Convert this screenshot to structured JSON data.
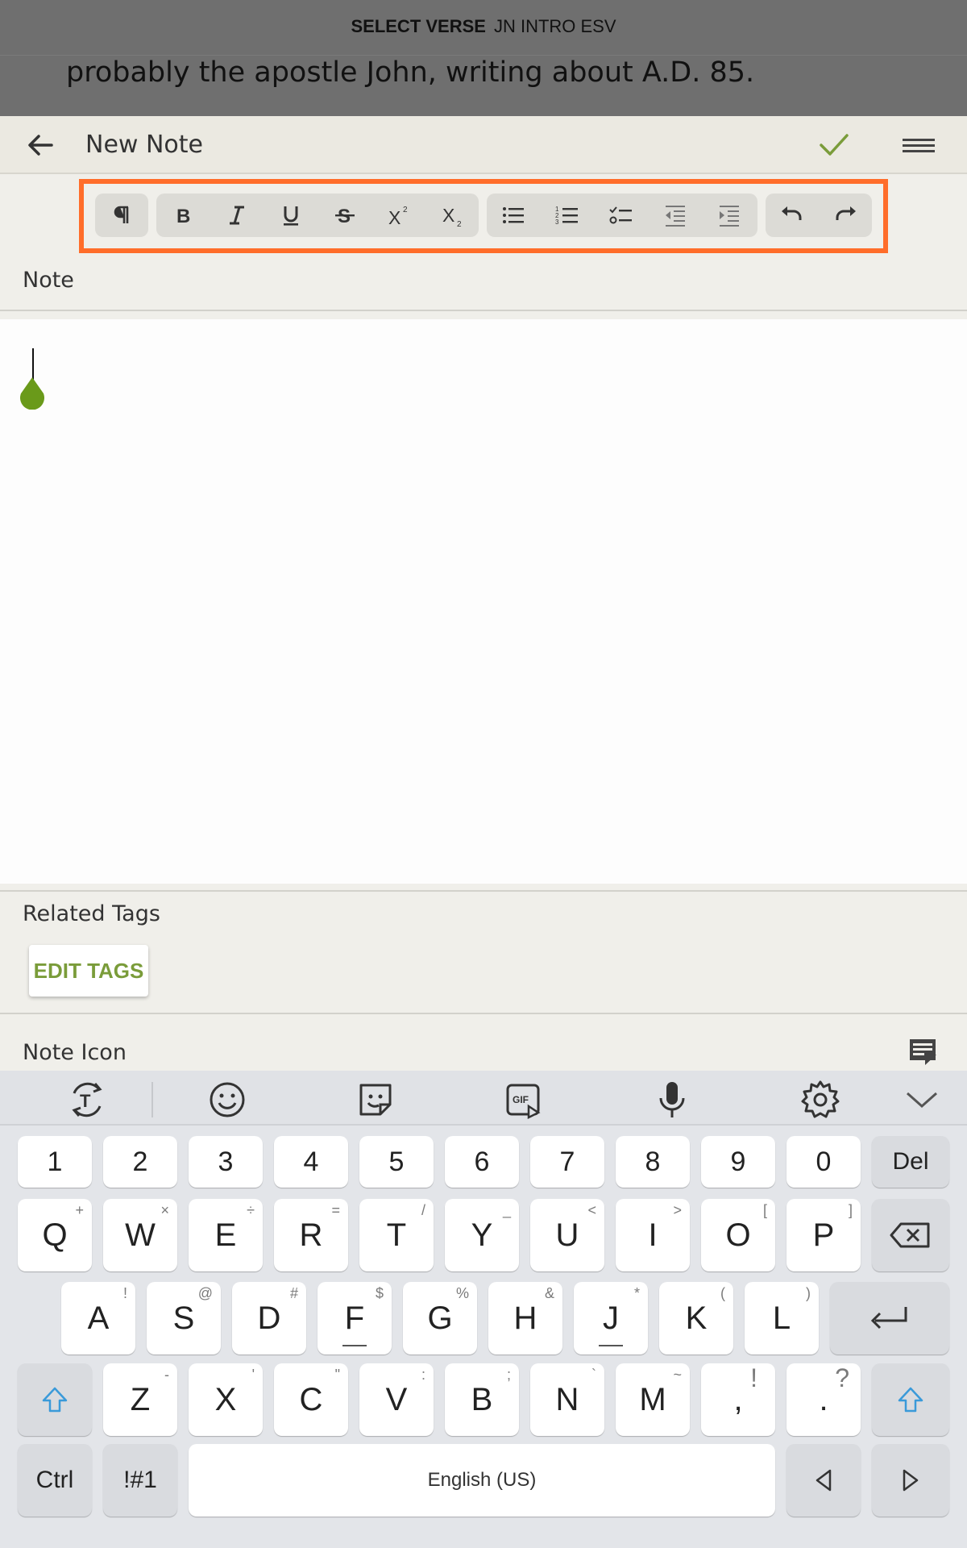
{
  "verse_bar": {
    "select_label": "SELECT VERSE",
    "reference": "JN INTRO ESV",
    "text": "probably the apostle John, writing about A.D. 85."
  },
  "appbar": {
    "title": "New Note"
  },
  "colors": {
    "accent_green": "#7a9c3a",
    "toolbar_highlight": "#ff6d2a",
    "cursor_drop": "#6a9a1a"
  },
  "toolbar": {
    "groups": [
      [
        "paragraph-icon"
      ],
      [
        "bold-icon",
        "italic-icon",
        "underline-icon",
        "strikethrough-icon",
        "superscript-icon",
        "subscript-icon"
      ],
      [
        "bulleted-list-icon",
        "numbered-list-icon",
        "checklist-icon",
        "outdent-icon",
        "indent-icon"
      ],
      [
        "undo-icon",
        "redo-icon"
      ]
    ]
  },
  "note": {
    "label": "Note",
    "content": ""
  },
  "tags": {
    "label": "Related Tags",
    "edit_button": "EDIT TAGS"
  },
  "note_icon": {
    "label": "Note Icon"
  },
  "keyboard": {
    "tools": [
      "text-translate-icon",
      "emoji-icon",
      "sticker-icon",
      "gif-icon",
      "microphone-icon",
      "settings-icon",
      "collapse-icon"
    ],
    "number_row": [
      "1",
      "2",
      "3",
      "4",
      "5",
      "6",
      "7",
      "8",
      "9",
      "0",
      "Del"
    ],
    "row1": [
      {
        "k": "Q",
        "s": "+"
      },
      {
        "k": "W",
        "s": "×"
      },
      {
        "k": "E",
        "s": "÷"
      },
      {
        "k": "R",
        "s": "="
      },
      {
        "k": "T",
        "s": "/"
      },
      {
        "k": "Y",
        "s": "_"
      },
      {
        "k": "U",
        "s": "<"
      },
      {
        "k": "I",
        "s": ">"
      },
      {
        "k": "O",
        "s": "["
      },
      {
        "k": "P",
        "s": "]"
      }
    ],
    "row2": [
      {
        "k": "A",
        "s": "!"
      },
      {
        "k": "S",
        "s": "@"
      },
      {
        "k": "D",
        "s": "#"
      },
      {
        "k": "F",
        "s": "$"
      },
      {
        "k": "G",
        "s": "%"
      },
      {
        "k": "H",
        "s": "&"
      },
      {
        "k": "J",
        "s": "*"
      },
      {
        "k": "K",
        "s": "("
      },
      {
        "k": "L",
        "s": ")"
      }
    ],
    "row3": [
      {
        "k": "Z",
        "s": "-"
      },
      {
        "k": "X",
        "s": "'"
      },
      {
        "k": "C",
        "s": "\""
      },
      {
        "k": "V",
        "s": ":"
      },
      {
        "k": "B",
        "s": ";"
      },
      {
        "k": "N",
        "s": "`"
      },
      {
        "k": "M",
        "s": "~"
      },
      {
        "k": ",",
        "s": "!"
      },
      {
        "k": ".",
        "s": "?"
      }
    ],
    "ctrl": "Ctrl",
    "symbols": "!#1",
    "space": "English (US)"
  }
}
